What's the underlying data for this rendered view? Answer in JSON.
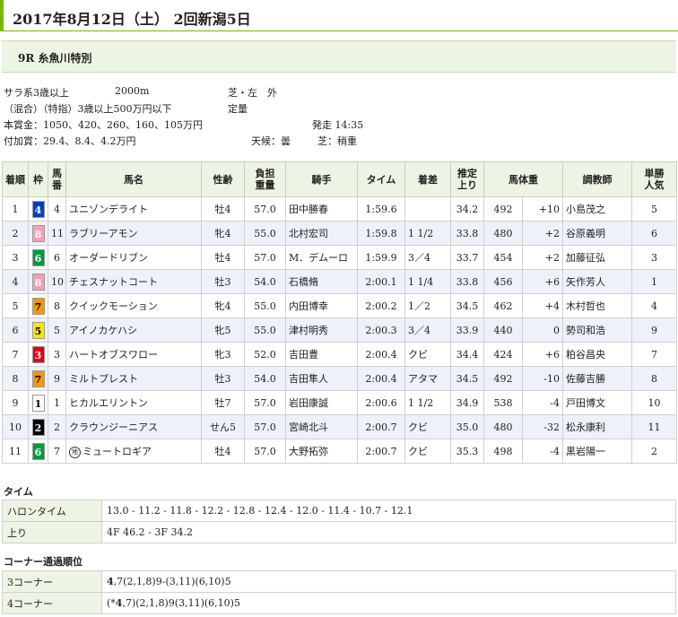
{
  "header": {
    "title": "2017年8月12日（土） 2回新潟5日"
  },
  "race": {
    "name": "9R 糸魚川特別"
  },
  "conditions": {
    "class": "サラ系3歳以上",
    "distance": "2000m",
    "surface": "芝・左　外",
    "rules": "（混合）（特指）3歳以上500万円以下",
    "weight_rule": "定量",
    "prize": "本賞金：1050、420、260、160、105万円",
    "start": "発走 14:35",
    "bonus": "付加賞：29.4、8.4、4.2万円",
    "weather": "天候：曇",
    "track": "芝：稍重"
  },
  "table": {
    "headers": {
      "rank": "着順",
      "frame": "枠",
      "num": "馬番",
      "horse": "馬名",
      "sexage": "性齢",
      "weight": "負担重量",
      "jockey": "騎手",
      "time": "タイム",
      "margin": "着差",
      "last3f": "推定上り",
      "bodyweight": "馬体重",
      "trainer": "調教師",
      "pop": "単勝人気"
    },
    "rows": [
      {
        "rank": "1",
        "frame": "4",
        "num": "4",
        "horse": "ユニゾンデライト",
        "sexage": "牡4",
        "weight": "57.0",
        "jockey": "田中勝春",
        "time": "1:59.6",
        "margin": "",
        "last3f": "34.2",
        "bw": "492",
        "bwd": "+10",
        "trainer": "小島茂之",
        "pop": "5"
      },
      {
        "rank": "2",
        "frame": "8",
        "num": "11",
        "horse": "ラブリーアモン",
        "sexage": "牝4",
        "weight": "55.0",
        "jockey": "北村宏司",
        "time": "1:59.8",
        "margin": "1 1/2",
        "last3f": "33.8",
        "bw": "480",
        "bwd": "+2",
        "trainer": "谷原義明",
        "pop": "6"
      },
      {
        "rank": "3",
        "frame": "6",
        "num": "6",
        "horse": "オーダードリブン",
        "sexage": "牡4",
        "weight": "57.0",
        "jockey": "M．デムーロ",
        "time": "1:59.9",
        "margin": "3／4",
        "last3f": "33.7",
        "bw": "454",
        "bwd": "+2",
        "trainer": "加藤征弘",
        "pop": "3"
      },
      {
        "rank": "4",
        "frame": "8",
        "num": "10",
        "horse": "チェスナットコート",
        "sexage": "牡3",
        "weight": "54.0",
        "jockey": "石橋脩",
        "time": "2:00.1",
        "margin": "1 1/4",
        "last3f": "33.8",
        "bw": "456",
        "bwd": "+6",
        "trainer": "矢作芳人",
        "pop": "1"
      },
      {
        "rank": "5",
        "frame": "7",
        "num": "8",
        "horse": "クイックモーション",
        "sexage": "牝4",
        "weight": "55.0",
        "jockey": "内田博幸",
        "time": "2:00.2",
        "margin": "1／2",
        "last3f": "34.5",
        "bw": "462",
        "bwd": "+4",
        "trainer": "木村哲也",
        "pop": "4"
      },
      {
        "rank": "6",
        "frame": "5",
        "num": "5",
        "horse": "アイノカケハシ",
        "sexage": "牝5",
        "weight": "55.0",
        "jockey": "津村明秀",
        "time": "2:00.3",
        "margin": "3／4",
        "last3f": "33.9",
        "bw": "440",
        "bwd": "0",
        "trainer": "勢司和浩",
        "pop": "9"
      },
      {
        "rank": "7",
        "frame": "3",
        "num": "3",
        "horse": "ハートオブスワロー",
        "sexage": "牝3",
        "weight": "52.0",
        "jockey": "吉田豊",
        "time": "2:00.4",
        "margin": "クビ",
        "last3f": "34.4",
        "bw": "424",
        "bwd": "+6",
        "trainer": "粕谷昌央",
        "pop": "7"
      },
      {
        "rank": "8",
        "frame": "7",
        "num": "9",
        "horse": "ミルトプレスト",
        "sexage": "牡3",
        "weight": "54.0",
        "jockey": "吉田隼人",
        "time": "2:00.4",
        "margin": "アタマ",
        "last3f": "34.5",
        "bw": "492",
        "bwd": "-10",
        "trainer": "佐藤吉勝",
        "pop": "8"
      },
      {
        "rank": "9",
        "frame": "1",
        "num": "1",
        "horse": "ヒカルエリントン",
        "sexage": "牡7",
        "weight": "57.0",
        "jockey": "岩田康誠",
        "time": "2:00.6",
        "margin": "1 1/2",
        "last3f": "34.9",
        "bw": "538",
        "bwd": "-4",
        "trainer": "戸田博文",
        "pop": "10"
      },
      {
        "rank": "10",
        "frame": "2",
        "num": "2",
        "horse": "クラウンジーニアス",
        "sexage": "せん5",
        "weight": "57.0",
        "jockey": "宮崎北斗",
        "time": "2:00.7",
        "margin": "クビ",
        "last3f": "35.0",
        "bw": "480",
        "bwd": "-32",
        "trainer": "松永康利",
        "pop": "11"
      },
      {
        "rank": "11",
        "frame": "6",
        "num": "7",
        "horse": "ミュートロギア",
        "icon": "地",
        "sexage": "牡4",
        "weight": "57.0",
        "jockey": "大野拓弥",
        "time": "2:00.7",
        "margin": "クビ",
        "last3f": "35.3",
        "bw": "498",
        "bwd": "-4",
        "trainer": "黒岩陽一",
        "pop": "2"
      }
    ]
  },
  "frame_colors": {
    "1": {
      "bg": "#ffffff",
      "fg": "#000000"
    },
    "2": {
      "bg": "#000000",
      "fg": "#ffffff"
    },
    "3": {
      "bg": "#e60012",
      "fg": "#ffffff"
    },
    "4": {
      "bg": "#0040c0",
      "fg": "#ffffff"
    },
    "5": {
      "bg": "#ffe500",
      "fg": "#000000"
    },
    "6": {
      "bg": "#009a3e",
      "fg": "#ffffff"
    },
    "7": {
      "bg": "#f39800",
      "fg": "#000000"
    },
    "8": {
      "bg": "#f5a0b5",
      "fg": "#ffffff"
    }
  },
  "times": {
    "section_title": "タイム",
    "furlong_label": "ハロンタイム",
    "furlong_value": "13.0 - 11.2 - 11.8 - 12.2 - 12.8 - 12.4 - 12.0 - 11.4 - 10.7 - 12.1",
    "last_label": "上り",
    "last_value": "4F 46.2 - 3F 34.2"
  },
  "corners": {
    "section_title": "コーナー通過順位",
    "c3_label": "3コーナー",
    "c3_lead": "4",
    "c3_rest": ",7(2,1,8)9-(3,11)(6,10)5",
    "c4_label": "4コーナー",
    "c4_pre": "(*",
    "c4_lead": "4",
    "c4_rest": ",7)(2,1,8)9(3,11)(6,10)5"
  }
}
